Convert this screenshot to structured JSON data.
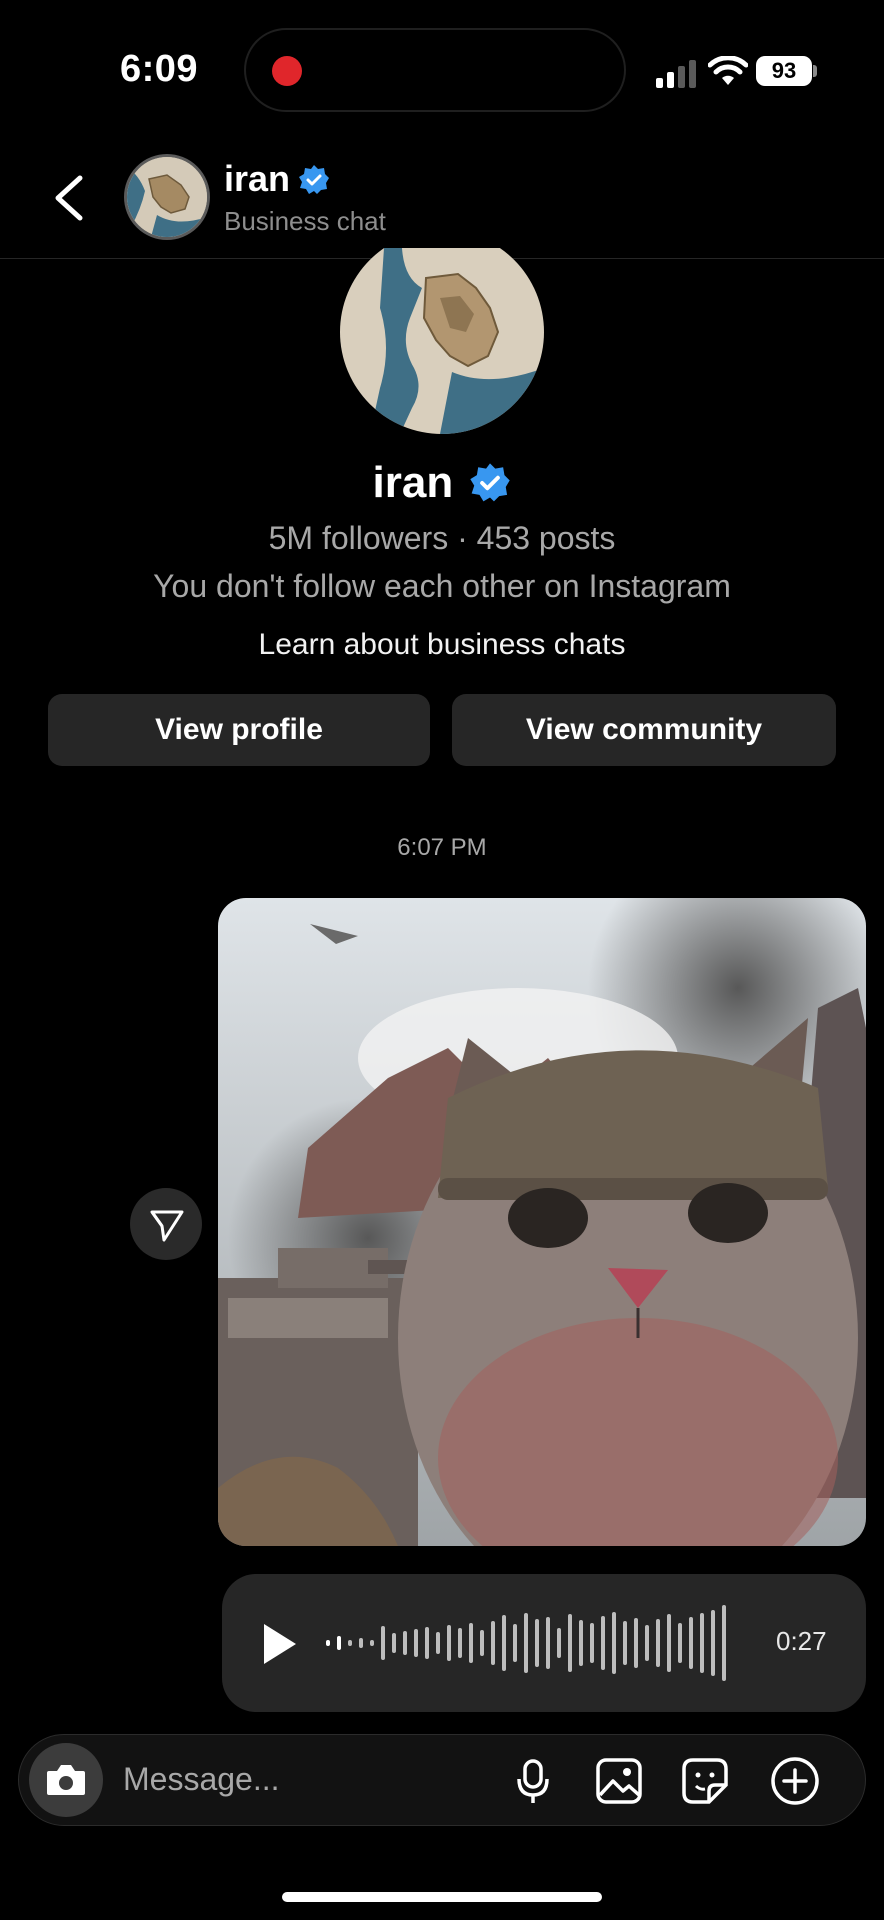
{
  "status_bar": {
    "time": "6:09",
    "battery": "93"
  },
  "header": {
    "name": "iran",
    "subtitle": "Business chat"
  },
  "profile": {
    "name": "iran",
    "stats": "5M followers · 453 posts",
    "follow_note": "You don't follow each other on Instagram",
    "learn_link": "Learn about business chats",
    "view_profile": "View profile",
    "view_community": "View community"
  },
  "thread": {
    "timestamp": "6:07 PM",
    "voice_duration": "0:27",
    "voice_progress": 0.06
  },
  "composer": {
    "placeholder": "Message..."
  },
  "colors": {
    "verified": "#3897f0",
    "record": "#e0262b",
    "background": "#000000"
  },
  "icons": [
    "back-icon",
    "verified-badge-icon",
    "direct-share-icon",
    "play-icon",
    "camera-icon",
    "microphone-icon",
    "gallery-icon",
    "sticker-icon",
    "plus-icon"
  ]
}
